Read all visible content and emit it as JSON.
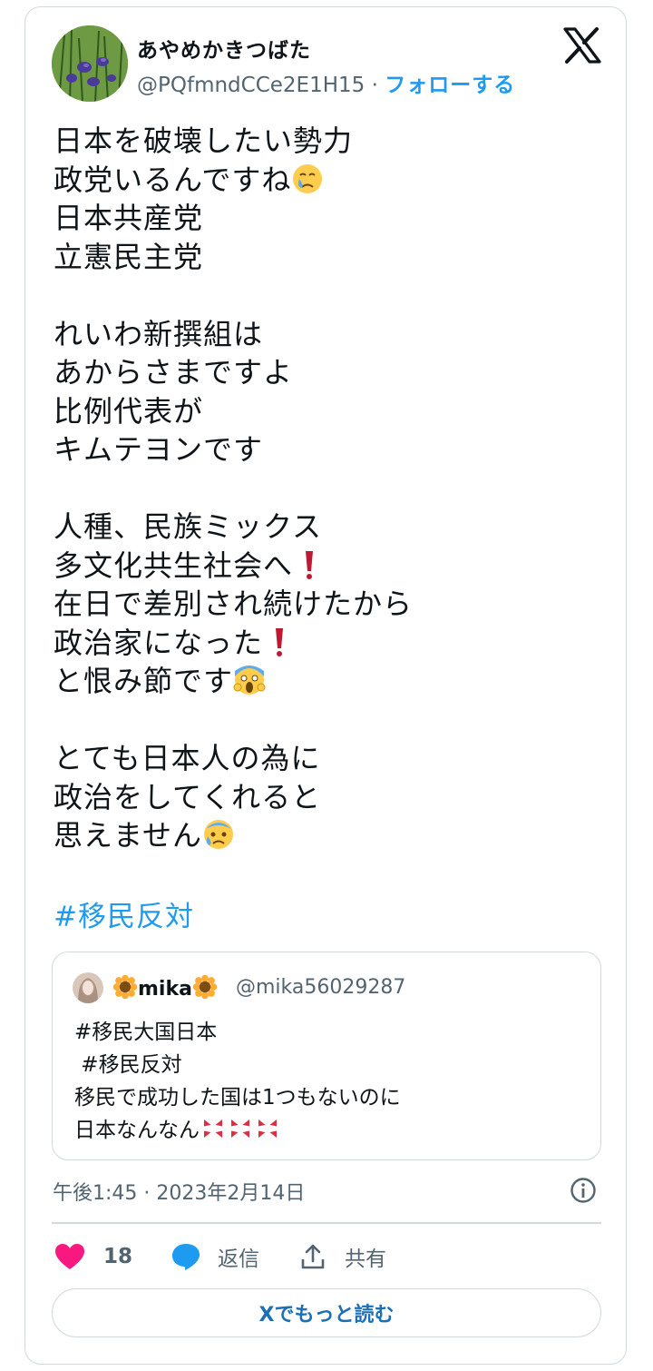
{
  "author": {
    "name": "あやめかきつばた",
    "handle": "@PQfmndCCe2E1H15",
    "separator": " · ",
    "follow_label": "フォローする"
  },
  "tweet": {
    "line1": "日本を破壊したい勢力",
    "line2a": "政党いるんですね",
    "line3": "日本共産党",
    "line4": "立憲民主党",
    "line5": "れいわ新撰組は",
    "line6": "あからさまですよ",
    "line7": "比例代表が",
    "line8": "キムテヨンです",
    "line9": "人種、民族ミックス",
    "line10a": "多文化共生社会へ",
    "line11": "在日で差別され続けたから",
    "line12a": "政治家になった",
    "line13a": "と恨み節です",
    "line14": "とても日本人の為に",
    "line15": "政治をしてくれると",
    "line16a": "思えません",
    "hashtag": "#移民反対",
    "emoji_crying": "crying-face",
    "emoji_exclaim": "red-exclamation",
    "emoji_scream": "screaming-face",
    "emoji_sweat": "anxious-sweat-face"
  },
  "quote": {
    "name": "mika",
    "handle": "@mika56029287",
    "line1": "#移民大国日本",
    "line2": " #移民反対",
    "line3": "移民で成功した国は1つもないのに",
    "line4": "日本なんなん",
    "emoji_sunflower": "sunflower",
    "emoji_anger": "anger-symbol"
  },
  "meta": {
    "timestamp": "午後1:45 · 2023年2月14日"
  },
  "actions": {
    "likes": "18",
    "reply_label": "返信",
    "share_label": "共有"
  },
  "read_more_label": "Xでもっと読む",
  "colors": {
    "accent": "#1d9bf0",
    "like": "#f91880",
    "text": "#0f1419",
    "muted": "#536471",
    "border": "#cfd9de"
  }
}
